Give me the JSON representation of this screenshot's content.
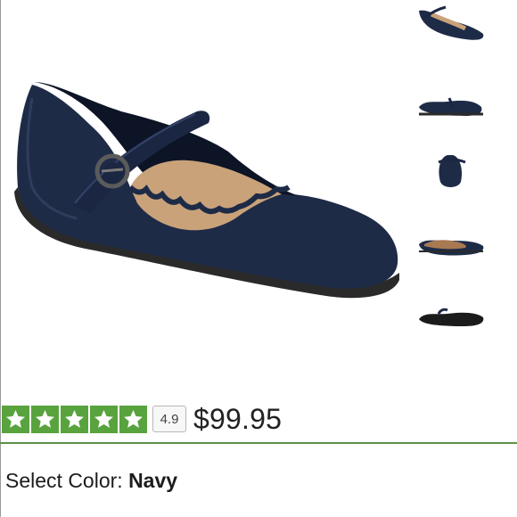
{
  "product": {
    "main_image_alt": "navy mary jane flat",
    "thumbnails": [
      {
        "name": "angled view"
      },
      {
        "name": "side view"
      },
      {
        "name": "front view"
      },
      {
        "name": "inner side view"
      },
      {
        "name": "sole view"
      }
    ]
  },
  "rating": {
    "value": "4.9",
    "stars_filled": 5,
    "stars_total": 5,
    "star_color": "#58a33d"
  },
  "price": "$99.95",
  "color_select": {
    "label": "Select Color:",
    "value": "Navy"
  },
  "colors": {
    "shoe": "#1e2b47",
    "insole": "#c9a27a",
    "divider": "#5f8f45"
  }
}
